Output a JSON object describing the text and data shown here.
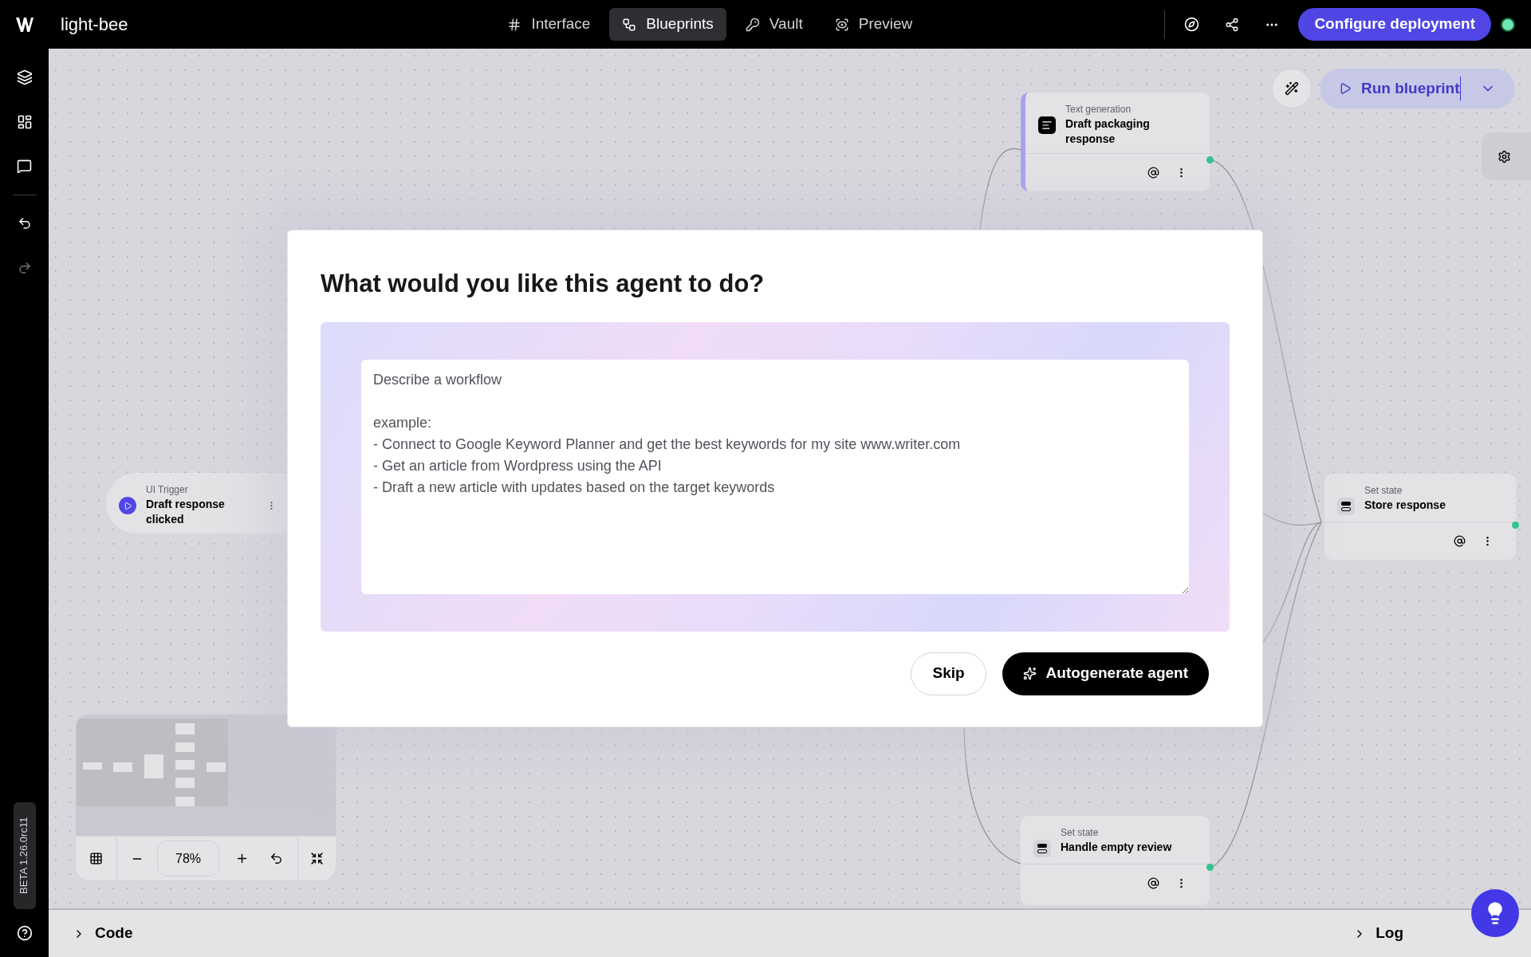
{
  "app": {
    "name": "light-bee"
  },
  "nav_tabs": [
    {
      "label": "Interface",
      "selected": false
    },
    {
      "label": "Blueprints",
      "selected": true
    },
    {
      "label": "Vault",
      "selected": false
    },
    {
      "label": "Preview",
      "selected": false
    }
  ],
  "deploy_button": "Configure deployment",
  "run_button": "Run blueprint",
  "nodes": [
    {
      "kind": "generation",
      "type": "Text generation",
      "title": "Draft packaging response"
    },
    {
      "kind": "trigger",
      "type": "UI Trigger",
      "title": "Draft response clicked"
    },
    {
      "kind": "state",
      "type": "Set state",
      "title": "Store response"
    },
    {
      "kind": "state",
      "type": "Set state",
      "title": "Handle empty review"
    }
  ],
  "zoom": {
    "value": "78%"
  },
  "version_badge": "BETA 1.26.0rc11",
  "bottom_panel": {
    "left": "Code",
    "right": "Log"
  },
  "dialog": {
    "title": "What would you like this agent to do?",
    "placeholder": "Describe a workflow\n\nexample:\n- Connect to Google Keyword Planner and get the best keywords for my site www.writer.com\n- Get an article from Wordpress using the API\n- Draft a new article with updates based on the target keywords",
    "buttons": [
      "Skip",
      "Autogenerate agent"
    ]
  }
}
